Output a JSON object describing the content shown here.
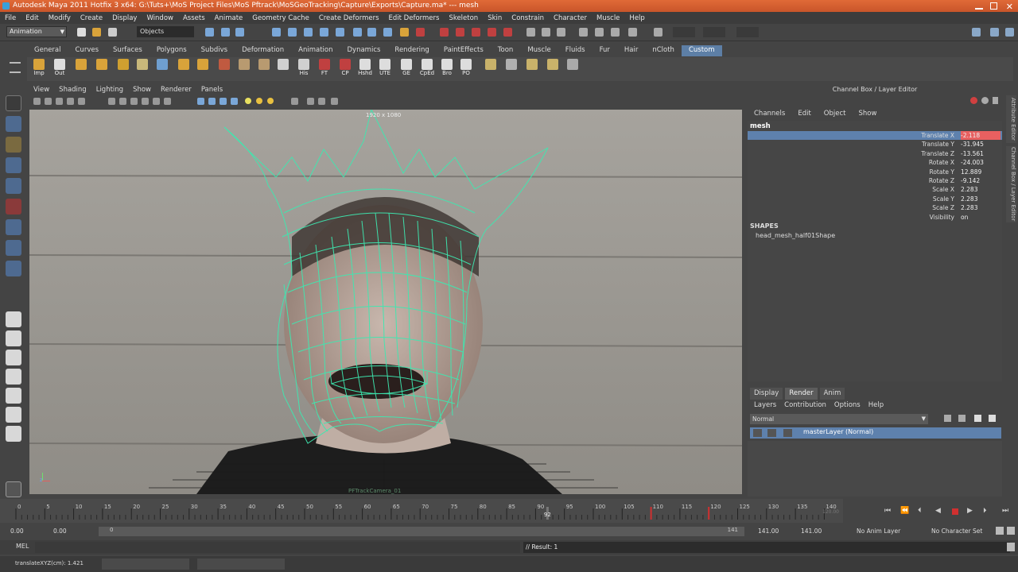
{
  "window": {
    "title": "Autodesk Maya 2011 Hotfix 3 x64: G:\\Tuts+\\MoS Project Files\\MoS Pftrack\\MoSGeoTracking\\Capture\\Exports\\Capture.ma*   ---   mesh"
  },
  "menubar": [
    "File",
    "Edit",
    "Modify",
    "Create",
    "Display",
    "Window",
    "Assets",
    "Animate",
    "Geometry Cache",
    "Create Deformers",
    "Edit Deformers",
    "Skeleton",
    "Skin",
    "Constrain",
    "Character",
    "Muscle",
    "Help"
  ],
  "statusline": {
    "mode": "Animation",
    "selection_field": "Objects"
  },
  "shelf": {
    "tabs": [
      "General",
      "Curves",
      "Surfaces",
      "Polygons",
      "Subdivs",
      "Deformation",
      "Animation",
      "Dynamics",
      "Rendering",
      "PaintEffects",
      "Toon",
      "Muscle",
      "Fluids",
      "Fur",
      "Hair",
      "nCloth",
      "Custom"
    ],
    "active_tab": "Custom",
    "items": [
      {
        "label": "Imp",
        "color": "#d9a33a"
      },
      {
        "label": "Out",
        "color": "#dddddd"
      },
      {
        "label": "",
        "color": "#d9a33a"
      },
      {
        "label": "",
        "color": "#d9a33a"
      },
      {
        "label": "",
        "color": "#cfa030"
      },
      {
        "label": "",
        "color": "#c8b87a"
      },
      {
        "label": "",
        "color": "#6f9fd0"
      },
      {
        "label": "",
        "color": "#d9a33a"
      },
      {
        "label": "",
        "color": "#d9a33a"
      },
      {
        "label": "",
        "color": "#c05a40"
      },
      {
        "label": "",
        "color": "#b89a70"
      },
      {
        "label": "",
        "color": "#b89a70"
      },
      {
        "label": "",
        "color": "#d0d0d0"
      },
      {
        "label": "His",
        "color": "#d0d0d0"
      },
      {
        "label": "FT",
        "color": "#c04040"
      },
      {
        "label": "CP",
        "color": "#c04040"
      },
      {
        "label": "Hshd",
        "color": "#dddddd"
      },
      {
        "label": "UTE",
        "color": "#dddddd"
      },
      {
        "label": "GE",
        "color": "#dddddd"
      },
      {
        "label": "CpEd",
        "color": "#dddddd"
      },
      {
        "label": "Bro",
        "color": "#dddddd"
      },
      {
        "label": "PO",
        "color": "#dddddd"
      },
      {
        "label": "",
        "color": "#c9b26a"
      },
      {
        "label": "",
        "color": "#b0b0b0"
      },
      {
        "label": "",
        "color": "#c9b26a"
      },
      {
        "label": "",
        "color": "#c9b26a"
      },
      {
        "label": "",
        "color": "#aaaaaa"
      }
    ]
  },
  "viewport": {
    "menus": [
      "View",
      "Shading",
      "Lighting",
      "Show",
      "Renderer",
      "Panels"
    ],
    "resolution_label": "1920 x 1080",
    "camera_label": "PFTrackCamera_01"
  },
  "channel_box": {
    "title": "Channel Box / Layer Editor",
    "menus": [
      "Channels",
      "Edit",
      "Object",
      "Show"
    ],
    "object_name": "mesh",
    "attributes": [
      {
        "name": "Translate X",
        "value": "-2.118",
        "selected": true
      },
      {
        "name": "Translate Y",
        "value": "-31.945",
        "selected": false
      },
      {
        "name": "Translate Z",
        "value": "-13.561",
        "selected": false
      },
      {
        "name": "Rotate X",
        "value": "-24.003",
        "selected": false
      },
      {
        "name": "Rotate Y",
        "value": "12.889",
        "selected": false
      },
      {
        "name": "Rotate Z",
        "value": "-9.142",
        "selected": false
      },
      {
        "name": "Scale X",
        "value": "2.283",
        "selected": false
      },
      {
        "name": "Scale Y",
        "value": "2.283",
        "selected": false
      },
      {
        "name": "Scale Z",
        "value": "2.283",
        "selected": false
      },
      {
        "name": "Visibility",
        "value": "on",
        "selected": false
      }
    ],
    "shapes_header": "SHAPES",
    "shape_name": "head_mesh_half01Shape"
  },
  "layer_editor": {
    "tabs": [
      "Display",
      "Render",
      "Anim"
    ],
    "active_tab": "Render",
    "menus": [
      "Layers",
      "Contribution",
      "Options",
      "Help"
    ],
    "blend_mode": "Normal",
    "layer_name": "masterLayer (Normal)"
  },
  "time_slider": {
    "ticks": [
      "0",
      "5",
      "10",
      "15",
      "20",
      "25",
      "30",
      "35",
      "40",
      "45",
      "50",
      "55",
      "60",
      "65",
      "70",
      "75",
      "80",
      "85",
      "90",
      "95",
      "100",
      "105",
      "110",
      "115",
      "120",
      "125",
      "130",
      "135",
      "140"
    ],
    "current_frame": "92",
    "end_marker": "120.00"
  },
  "range_slider": {
    "start_time": "0.00",
    "playback_start": "0.00",
    "range_start_label": "0",
    "range_end_label": "141",
    "playback_end": "141.00",
    "end_time": "141.00",
    "anim_layer": "No Anim Layer",
    "character_set": "No Character Set"
  },
  "command_line": {
    "label": "MEL",
    "result": "// Result: 1"
  },
  "help_line": {
    "text": "translateXYZ(cm):     1.421"
  },
  "side_tabs": [
    "Attribute Editor",
    "Channel Box / Layer Editor"
  ],
  "colors": {
    "title_bar": "#d35f2f",
    "selection_blue": "#5e81ad",
    "keyed_red": "#e86060",
    "wireframe": "#3ee8b0"
  }
}
